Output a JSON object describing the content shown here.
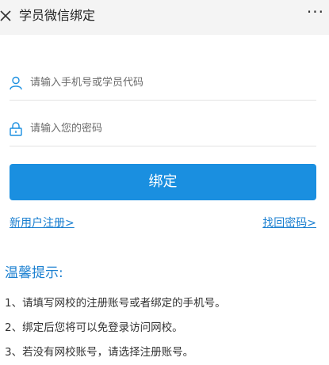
{
  "header": {
    "title": "学员微信绑定",
    "more": "···"
  },
  "form": {
    "account_placeholder": "请输入手机号或学员代码",
    "password_placeholder": "请输入您的密码",
    "bind_label": "绑定",
    "register_link": "新用户注册>",
    "forgot_link": "找回密码>"
  },
  "tips": {
    "title": "温馨提示:",
    "items": [
      "1、请填写网校的注册账号或者绑定的手机号。",
      "2、绑定后您将可以免登录访问网校。",
      "3、若没有网校账号，请选择注册账号。"
    ]
  },
  "colors": {
    "accent": "#1a8fe0",
    "link": "#1a7fd0",
    "header_bg": "#f4f4f4"
  }
}
